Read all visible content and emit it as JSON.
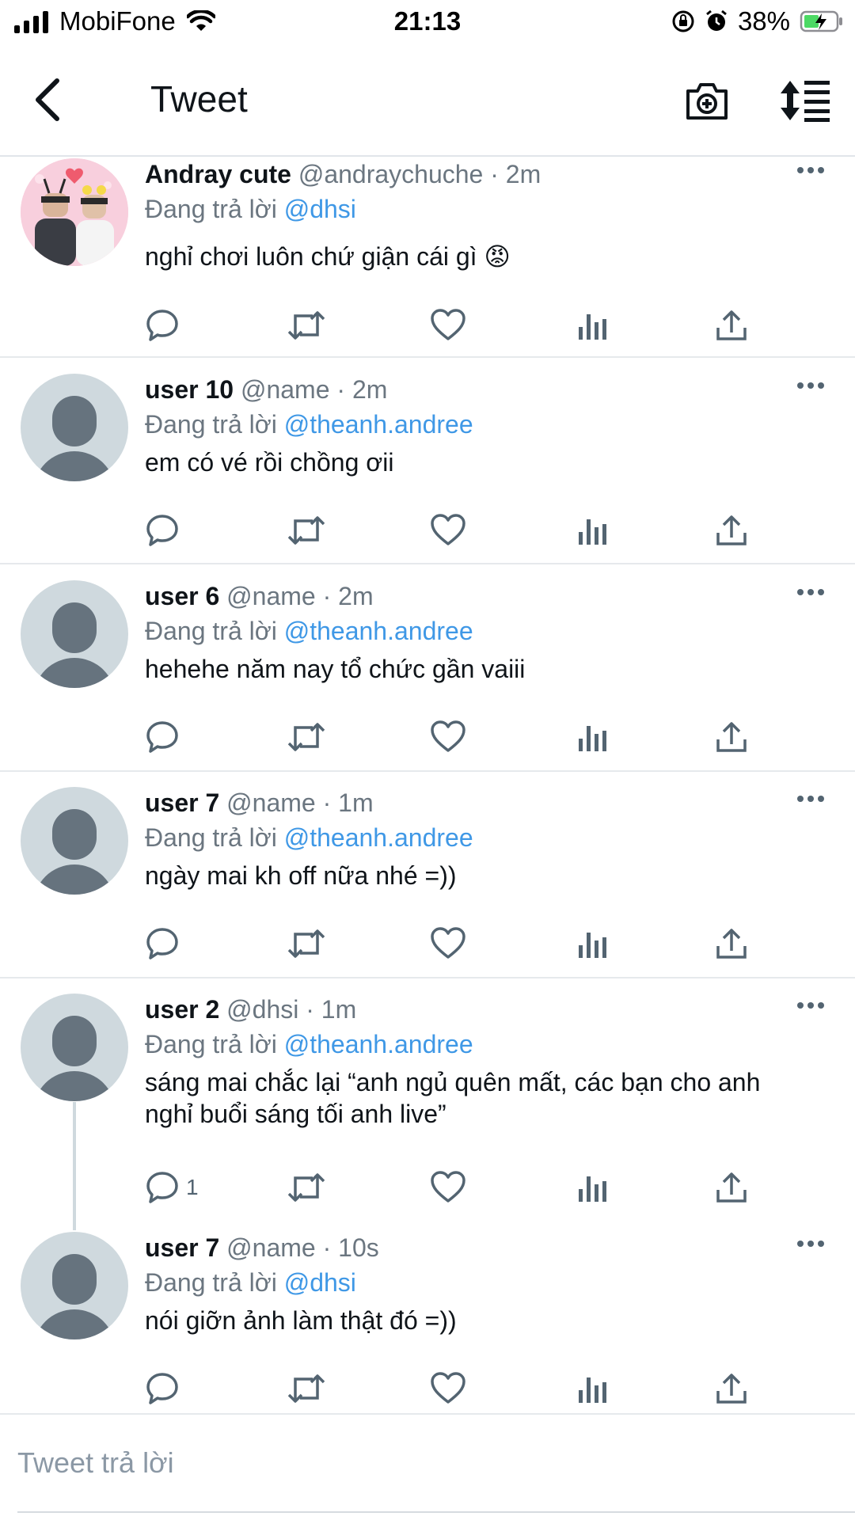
{
  "status_bar": {
    "carrier": "MobiFone",
    "time": "21:13",
    "battery": "38%"
  },
  "header": {
    "title": "Tweet",
    "back_icon": "chevron-left-icon",
    "camera_icon": "camera-plus-icon",
    "sort_icon": "sort-list-icon"
  },
  "tweets": [
    {
      "name": "Andray cute",
      "handle": "@andraychuche",
      "dot": "·",
      "time": "2m",
      "replying_prefix": "Đang trả lời",
      "replying_to": "@dhsi",
      "text": "nghỉ chơi luôn chứ giận cái gì 😡",
      "reply_count": ""
    },
    {
      "name": "user 10",
      "handle": "@name",
      "dot": "·",
      "time": "2m",
      "replying_prefix": "Đang trả lời",
      "replying_to": "@theanh.andree",
      "text": "em có vé rồi chồng ơii",
      "reply_count": ""
    },
    {
      "name": "user 6",
      "handle": "@name",
      "dot": "·",
      "time": "2m",
      "replying_prefix": "Đang trả lời",
      "replying_to": "@theanh.andree",
      "text": "hehehe năm nay tổ chức gần vaiii",
      "reply_count": ""
    },
    {
      "name": "user 7",
      "handle": "@name",
      "dot": "·",
      "time": "1m",
      "replying_prefix": "Đang trả lời",
      "replying_to": "@theanh.andree",
      "text": "ngày mai kh off nữa nhé =))",
      "reply_count": ""
    },
    {
      "name": "user 2",
      "handle": "@dhsi",
      "dot": "·",
      "time": "1m",
      "replying_prefix": "Đang trả lời",
      "replying_to": "@theanh.andree",
      "text_lines": [
        "sáng mai chắc lại “anh ngủ quên mất, các bạn cho anh",
        "nghỉ buổi sáng tối anh live”"
      ],
      "reply_count": "1"
    },
    {
      "name": "user 7",
      "handle": "@name",
      "dot": "·",
      "time": "10s",
      "replying_prefix": "Đang trả lời",
      "replying_to": "@dhsi",
      "text": "nói giỡn ảnh làm thật đó =))",
      "reply_count": ""
    }
  ],
  "reply_bar": {
    "placeholder": "Tweet trả lời"
  },
  "colors": {
    "mention": "#3f98e6",
    "muted": "#6b7680",
    "icon": "#536471",
    "battery_charge": "#4cd964"
  }
}
